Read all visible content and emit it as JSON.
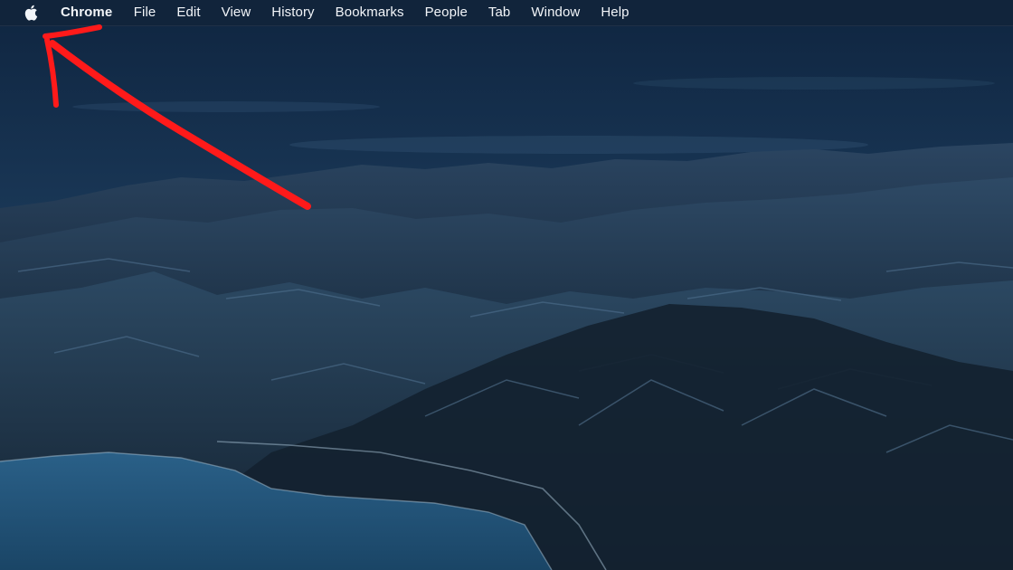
{
  "menubar": {
    "apple_icon": "apple-logo-icon",
    "app_name": "Chrome",
    "items": [
      {
        "label": "File"
      },
      {
        "label": "Edit"
      },
      {
        "label": "View"
      },
      {
        "label": "History"
      },
      {
        "label": "Bookmarks"
      },
      {
        "label": "People"
      },
      {
        "label": "Tab"
      },
      {
        "label": "Window"
      },
      {
        "label": "Help"
      }
    ]
  },
  "annotation": {
    "icon": "arrow-icon",
    "color": "#ff1a1a"
  },
  "colors": {
    "menubar_text": "#f2f5f9",
    "sky": "#1d3b5a",
    "mountains": "#1b2c3f",
    "water": "#2a5d86"
  }
}
